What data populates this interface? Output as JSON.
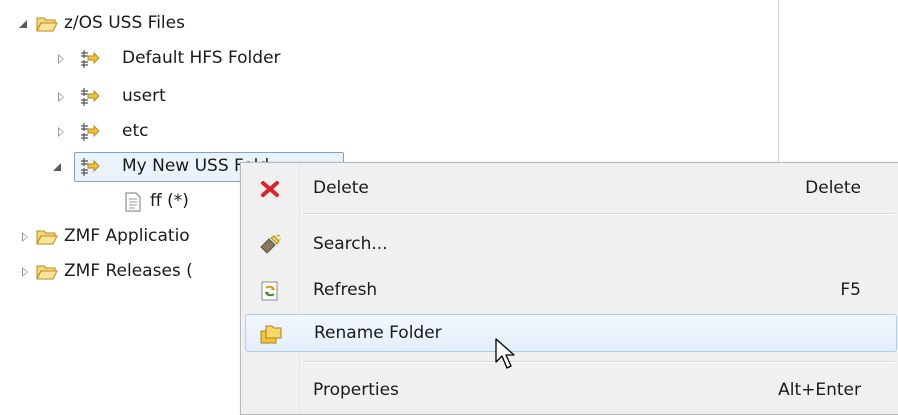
{
  "tree": {
    "root": {
      "label": "z/OS USS Files",
      "expanded": true
    },
    "children": [
      {
        "label": "Default HFS Folder",
        "expanded": false
      },
      {
        "label": "usert",
        "expanded": false
      },
      {
        "label": "etc",
        "expanded": false
      },
      {
        "label": "My New USS Fold",
        "expanded": true,
        "selected": true
      }
    ],
    "grandchild": {
      "label": "ff (*)"
    },
    "siblings": [
      {
        "label": "ZMF Applicatio",
        "expanded": false
      },
      {
        "label": "ZMF Releases (",
        "expanded": false
      }
    ]
  },
  "context_menu": {
    "items": [
      {
        "label": "Delete",
        "accelerator": "Delete",
        "icon": "delete-x-icon"
      },
      {
        "label": "Search...",
        "accelerator": "",
        "icon": "search-flashlight-icon"
      },
      {
        "label": "Refresh",
        "accelerator": "F5",
        "icon": "refresh-icon"
      },
      {
        "label": "Rename Folder",
        "accelerator": "",
        "icon": "rename-folder-icon",
        "highlighted": true
      },
      {
        "label": "Properties",
        "accelerator": "Alt+Enter",
        "icon": ""
      }
    ]
  },
  "colors": {
    "selection_border": "#7da2ce",
    "highlight_border": "#aecdf0",
    "folder": "#e8b746",
    "delete_x": "#d6262c"
  }
}
